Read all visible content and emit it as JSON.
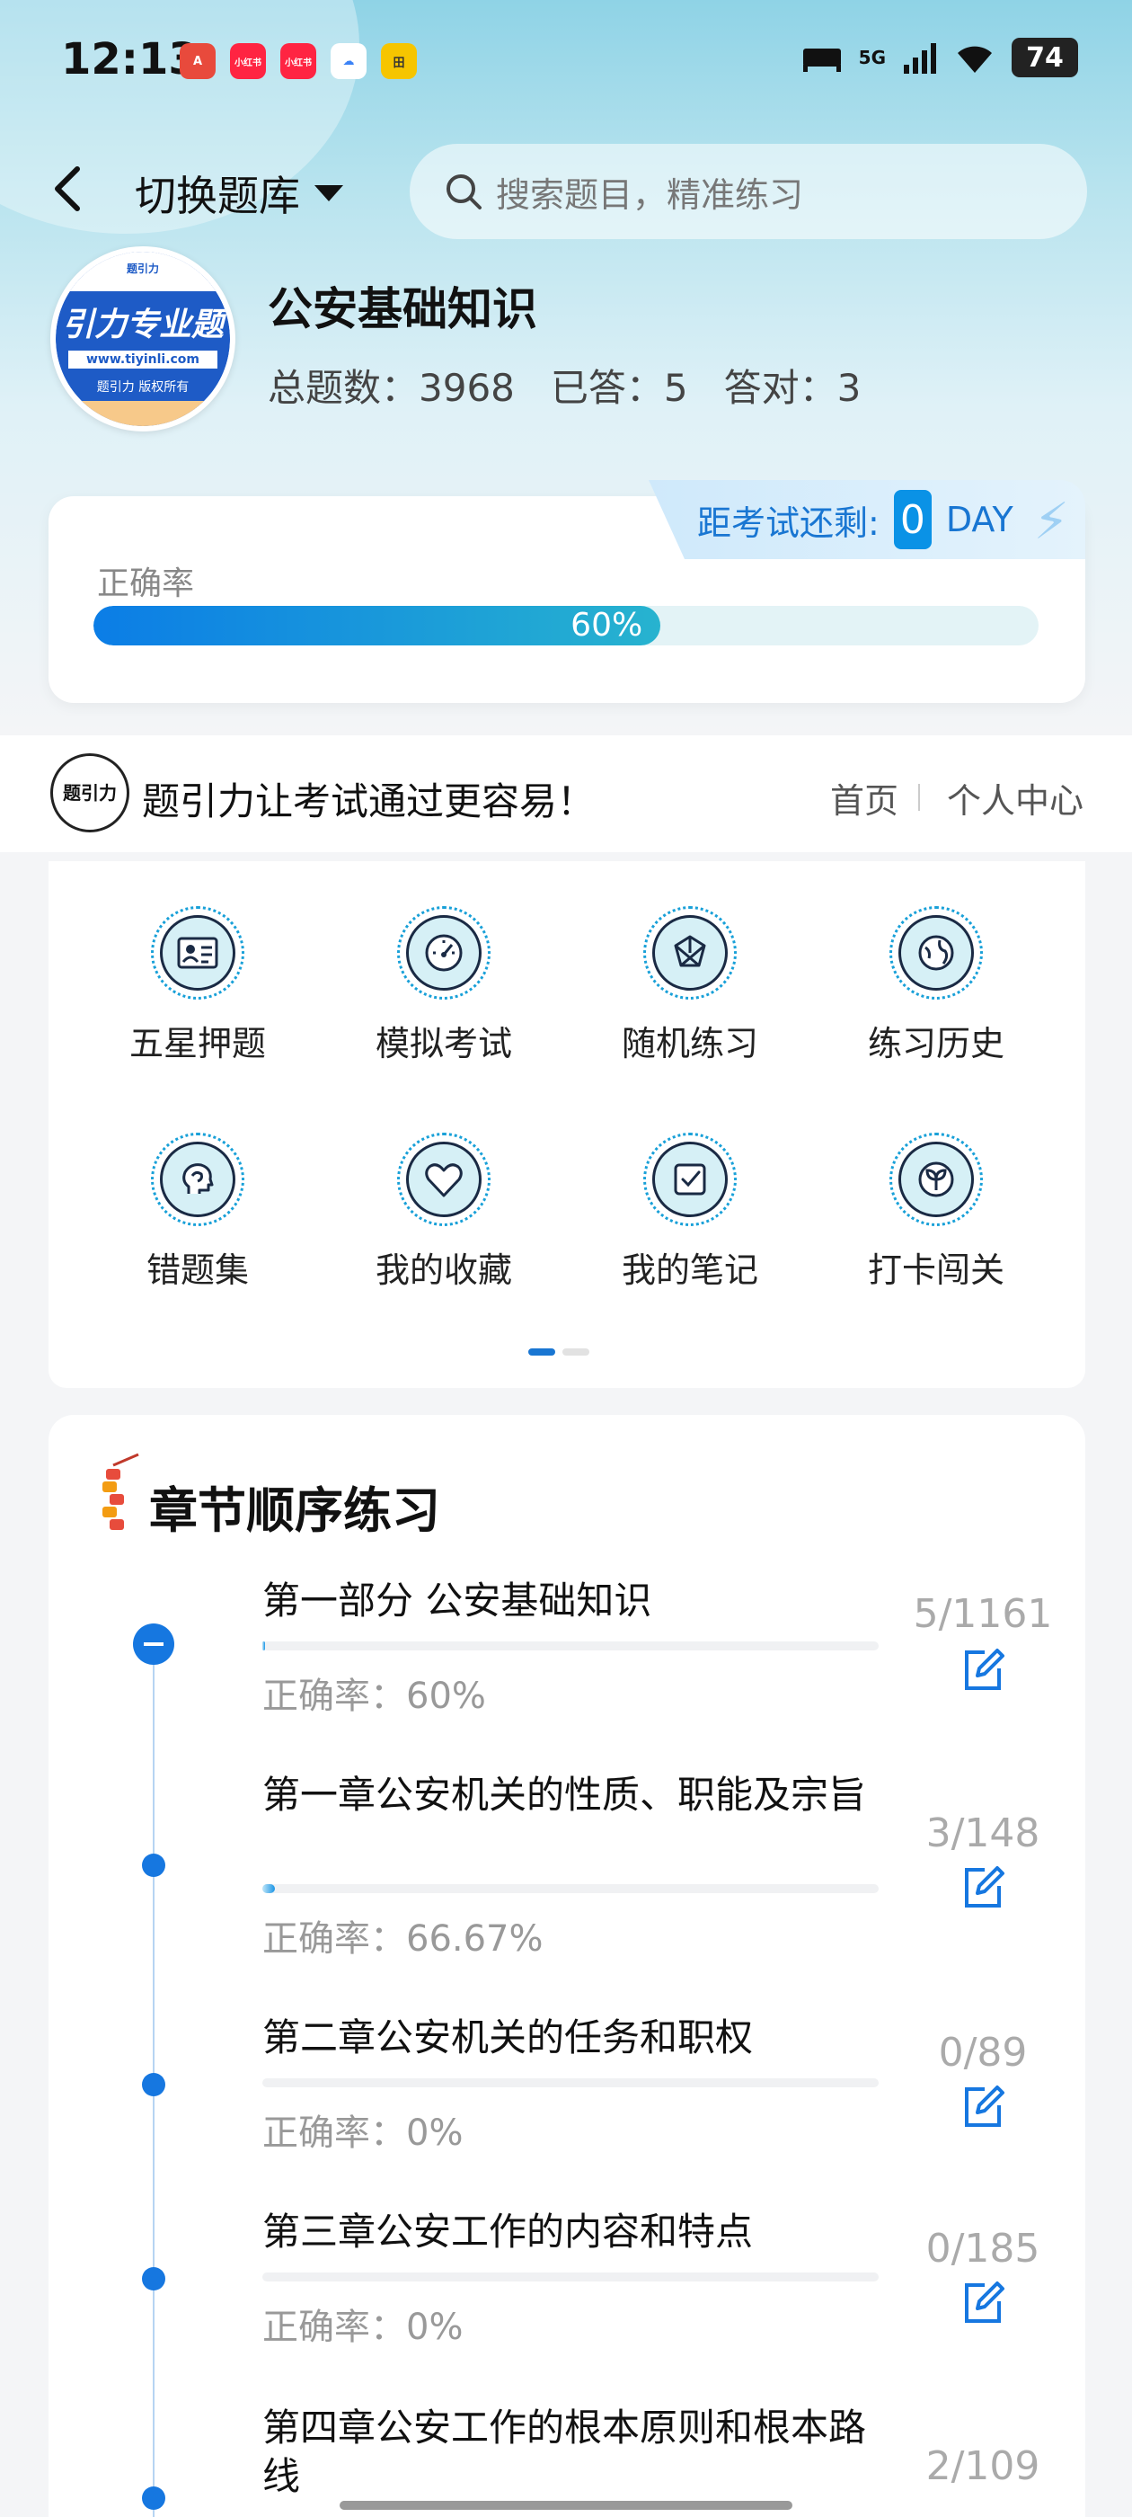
{
  "status_bar": {
    "time": "12:13",
    "network": "5G",
    "battery": "74",
    "notif_icons": [
      {
        "icon": "app-icon-red-a",
        "color": "#e84a3c",
        "label": "A"
      },
      {
        "icon": "xiaohongshu-icon",
        "color": "#ff2442",
        "label": "小红书"
      },
      {
        "icon": "xiaohongshu-icon",
        "color": "#ff2442",
        "label": "小红书"
      },
      {
        "icon": "app-icon-blue-cloud",
        "color": "#3b82f6",
        "label": "☁"
      },
      {
        "icon": "app-icon-yellow",
        "color": "#f6c500",
        "label": "田"
      }
    ]
  },
  "header": {
    "switch_label": "切换题库",
    "search_placeholder": "搜索题目，精准练习"
  },
  "bank": {
    "logo_top": "题引力",
    "logo_main": "引力专业题",
    "logo_url": "www.tiyinli.com",
    "logo_copy": "题引力 版权所有",
    "title": "公安基础知识",
    "total_label": "总题数：3968",
    "answered_label": "已答：5",
    "correct_label": "答对：3"
  },
  "accuracy": {
    "countdown_label": "距考试还剩:",
    "countdown_value": "0",
    "countdown_unit": "DAY",
    "label": "正确率",
    "percent_text": "60%",
    "percent": 0.6
  },
  "banner": {
    "brand_icon_text": "题引力",
    "slogan": "题引力让考试通过更容易！",
    "nav_home": "首页",
    "nav_personal": "个人中心"
  },
  "features": [
    {
      "label": "五星押题",
      "icon": "id-card-icon"
    },
    {
      "label": "模拟考试",
      "icon": "speedometer-icon"
    },
    {
      "label": "随机练习",
      "icon": "network-icon"
    },
    {
      "label": "练习历史",
      "icon": "globe-icon"
    },
    {
      "label": "错题集",
      "icon": "head-icon"
    },
    {
      "label": "我的收藏",
      "icon": "heart-icon"
    },
    {
      "label": "我的笔记",
      "icon": "note-check-icon"
    },
    {
      "label": "打卡闯关",
      "icon": "sprout-icon"
    }
  ],
  "chapters_section": {
    "title": "章节顺序练习",
    "items": [
      {
        "title": "第一部分 公安基础知识",
        "accuracy": "正确率：60%",
        "count": "5/1161",
        "progress": 0.0043
      },
      {
        "title": "第一章公安机关的性质、职能及宗旨",
        "accuracy": "正确率：66.67%",
        "count": "3/148",
        "progress": 0.02
      },
      {
        "title": "第二章公安机关的任务和职权",
        "accuracy": "正确率：0%",
        "count": "0/89",
        "progress": 0
      },
      {
        "title": "第三章公安工作的内容和特点",
        "accuracy": "正确率：0%",
        "count": "0/185",
        "progress": 0
      },
      {
        "title": "第四章公安工作的根本原则和根本路线",
        "accuracy": "",
        "count": "2/109",
        "progress": 0.018
      }
    ]
  }
}
